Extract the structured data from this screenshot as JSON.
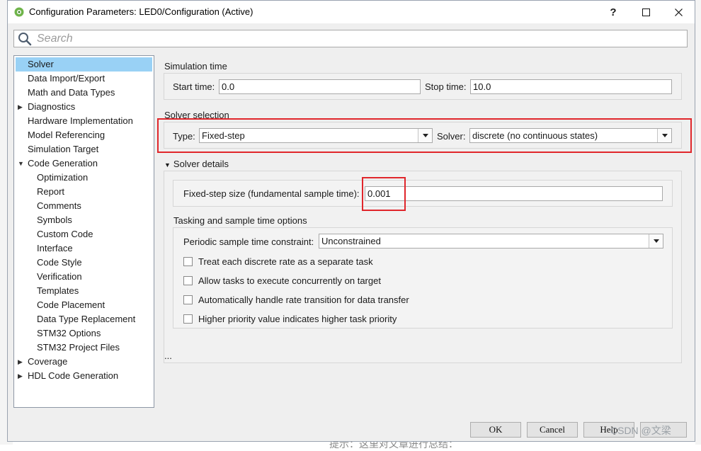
{
  "window": {
    "title": "Configuration Parameters: LED0/Configuration (Active)",
    "help_glyph": "?",
    "max_glyph": "☐",
    "close_glyph": "✕"
  },
  "search": {
    "placeholder": "Search"
  },
  "tree": {
    "items": [
      {
        "label": "Solver",
        "level": 0,
        "arrow": "",
        "selected": true
      },
      {
        "label": "Data Import/Export",
        "level": 0,
        "arrow": ""
      },
      {
        "label": "Math and Data Types",
        "level": 0,
        "arrow": ""
      },
      {
        "label": "Diagnostics",
        "level": 0,
        "arrow": "▶"
      },
      {
        "label": "Hardware Implementation",
        "level": 0,
        "arrow": ""
      },
      {
        "label": "Model Referencing",
        "level": 0,
        "arrow": ""
      },
      {
        "label": "Simulation Target",
        "level": 0,
        "arrow": ""
      },
      {
        "label": "Code Generation",
        "level": 0,
        "arrow": "▼"
      },
      {
        "label": "Optimization",
        "level": 1,
        "arrow": ""
      },
      {
        "label": "Report",
        "level": 1,
        "arrow": ""
      },
      {
        "label": "Comments",
        "level": 1,
        "arrow": ""
      },
      {
        "label": "Symbols",
        "level": 1,
        "arrow": ""
      },
      {
        "label": "Custom Code",
        "level": 1,
        "arrow": ""
      },
      {
        "label": "Interface",
        "level": 1,
        "arrow": ""
      },
      {
        "label": "Code Style",
        "level": 1,
        "arrow": ""
      },
      {
        "label": "Verification",
        "level": 1,
        "arrow": ""
      },
      {
        "label": "Templates",
        "level": 1,
        "arrow": ""
      },
      {
        "label": "Code Placement",
        "level": 1,
        "arrow": ""
      },
      {
        "label": "Data Type Replacement",
        "level": 1,
        "arrow": ""
      },
      {
        "label": "STM32 Options",
        "level": 1,
        "arrow": ""
      },
      {
        "label": "STM32 Project Files",
        "level": 1,
        "arrow": ""
      },
      {
        "label": "Coverage",
        "level": 0,
        "arrow": "▶"
      },
      {
        "label": "HDL Code Generation",
        "level": 0,
        "arrow": "▶"
      }
    ]
  },
  "simulation_time": {
    "title": "Simulation time",
    "start_label": "Start time:",
    "start_value": "0.0",
    "stop_label": "Stop time:",
    "stop_value": "10.0"
  },
  "solver_selection": {
    "title": "Solver selection",
    "type_label": "Type:",
    "type_value": "Fixed-step",
    "solver_label": "Solver:",
    "solver_value": "discrete (no continuous states)"
  },
  "solver_details": {
    "arrow": "▼",
    "title": "Solver details",
    "step_label": "Fixed-step size (fundamental sample time):",
    "step_value": "0.001",
    "tasking_title": "Tasking and sample time options",
    "constraint_label": "Periodic sample time constraint:",
    "constraint_value": "Unconstrained",
    "checks": [
      "Treat each discrete rate as a separate task",
      "Allow tasks to execute concurrently on target",
      "Automatically handle rate transition for data transfer",
      "Higher priority value indicates higher task priority"
    ]
  },
  "ellipsis": "...",
  "buttons": {
    "ok": "OK",
    "cancel": "Cancel",
    "help": "Help"
  },
  "background": {
    "bottom_text": "提示：这里对文章进行总结：",
    "watermark": "CSDN @文梁"
  },
  "colors": {
    "highlight_border": "#e0262b",
    "selection": "#99d1f5"
  }
}
